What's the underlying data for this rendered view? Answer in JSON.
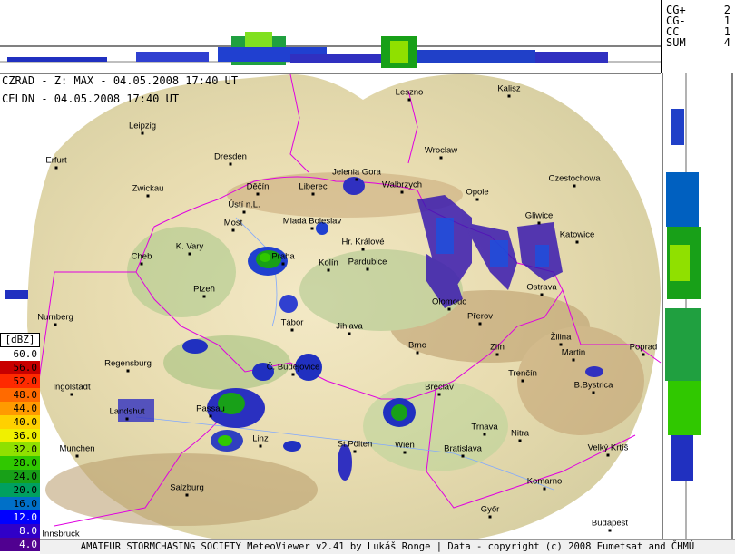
{
  "header": {
    "product_line": "CZRAD - Z: MAX - 04.05.2008 17:40 UT",
    "lightning_line": "CELDN - 04.05.2008 17:40 UT"
  },
  "lightning_counts": [
    {
      "label": "CG+",
      "value": "2"
    },
    {
      "label": "CG-",
      "value": "1"
    },
    {
      "label": "CC",
      "value": "1"
    },
    {
      "label": "SUM",
      "value": "4"
    }
  ],
  "legend": {
    "title": "[dBZ]",
    "levels": [
      {
        "label": "60.0",
        "color": "#ffffff",
        "text": "#000000"
      },
      {
        "label": "56.0",
        "color": "#c80000",
        "text": "#000000"
      },
      {
        "label": "52.0",
        "color": "#ff2a00",
        "text": "#000000"
      },
      {
        "label": "48.0",
        "color": "#ff6a00",
        "text": "#000000"
      },
      {
        "label": "44.0",
        "color": "#ff9a00",
        "text": "#000000"
      },
      {
        "label": "40.0",
        "color": "#ffd000",
        "text": "#000000"
      },
      {
        "label": "36.0",
        "color": "#f0f000",
        "text": "#000000"
      },
      {
        "label": "32.0",
        "color": "#90e000",
        "text": "#000000"
      },
      {
        "label": "28.0",
        "color": "#30c800",
        "text": "#000000"
      },
      {
        "label": "24.0",
        "color": "#18a018",
        "text": "#000000"
      },
      {
        "label": "20.0",
        "color": "#00a060",
        "text": "#000000"
      },
      {
        "label": "16.0",
        "color": "#0070c8",
        "text": "#000000"
      },
      {
        "label": "12.0",
        "color": "#0000ff",
        "text": "#ffffff"
      },
      {
        "label": "8.0",
        "color": "#3000c8",
        "text": "#ffffff"
      },
      {
        "label": "4.0",
        "color": "#500090",
        "text": "#ffffff"
      }
    ]
  },
  "cities": [
    {
      "name": "Leszno"
    },
    {
      "name": "Kalisz"
    },
    {
      "name": "Leipzig"
    },
    {
      "name": "Dresden"
    },
    {
      "name": "Wroclaw"
    },
    {
      "name": "Erfurt"
    },
    {
      "name": "Jelenia Gora"
    },
    {
      "name": "Czestochowa"
    },
    {
      "name": "Zwickau"
    },
    {
      "name": "Děčín"
    },
    {
      "name": "Liberec"
    },
    {
      "name": "Walbrzych"
    },
    {
      "name": "Opole"
    },
    {
      "name": "Ústí n.L."
    },
    {
      "name": "Mladá Boleslav"
    },
    {
      "name": "Gliwice"
    },
    {
      "name": "Katowice"
    },
    {
      "name": "Most"
    },
    {
      "name": "Hr. Králové"
    },
    {
      "name": "K. Vary"
    },
    {
      "name": "Praha"
    },
    {
      "name": "Cheb"
    },
    {
      "name": "Kolín"
    },
    {
      "name": "Pardubice"
    },
    {
      "name": "Ostrava"
    },
    {
      "name": "Plzeň"
    },
    {
      "name": "Olomouc"
    },
    {
      "name": "Přerov"
    },
    {
      "name": "Nurnberg"
    },
    {
      "name": "Tábor"
    },
    {
      "name": "Jihlava"
    },
    {
      "name": "Žilina"
    },
    {
      "name": "Brno"
    },
    {
      "name": "Zlín"
    },
    {
      "name": "Martin"
    },
    {
      "name": "Poprad"
    },
    {
      "name": "Regensburg"
    },
    {
      "name": "Č. Budějovice"
    },
    {
      "name": "Ingolstadt"
    },
    {
      "name": "Trenčín"
    },
    {
      "name": "B.Bystrica"
    },
    {
      "name": "Břeclav"
    },
    {
      "name": "Landshut"
    },
    {
      "name": "Passau"
    },
    {
      "name": "Trnava"
    },
    {
      "name": "Linz"
    },
    {
      "name": "Nitra"
    },
    {
      "name": "St.Pölten"
    },
    {
      "name": "Wien"
    },
    {
      "name": "Munchen"
    },
    {
      "name": "Bratislava"
    },
    {
      "name": "Velký Krtíš"
    },
    {
      "name": "Komarno"
    },
    {
      "name": "Salzburg"
    },
    {
      "name": "Győr"
    },
    {
      "name": "Budapest"
    },
    {
      "name": "Innsbruck"
    }
  ],
  "footer": {
    "text": "AMATEUR STORMCHASING SOCIETY MeteoViewer v2.41 by Lukáš Ronge | Data - copyright (c) 2008 Eumetsat and ČHMÚ"
  }
}
